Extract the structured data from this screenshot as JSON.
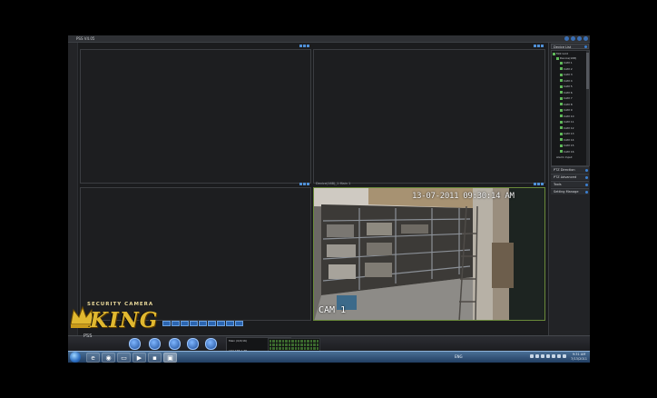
{
  "window": {
    "title": "PSS  V4.05"
  },
  "panes": [
    {
      "title": ""
    },
    {
      "title": ""
    },
    {
      "title": ""
    },
    {
      "title": "Device(168)_1 Main 1",
      "timestamp": "13-07-2011 09:30:14 AM",
      "channel": "CAM 1"
    }
  ],
  "right_panel": {
    "device_list_label": "Device List",
    "tree_root": "Mot Grid",
    "tree_device": "Device(168)",
    "cameras": [
      "CAM 1",
      "CAM 2",
      "CAM 3",
      "CAM 4",
      "CAM 5",
      "CAM 6",
      "CAM 7",
      "CAM 8",
      "CAM 9",
      "CAM 10",
      "CAM 11",
      "CAM 12",
      "CAM 13",
      "CAM 14",
      "CAM 15",
      "CAM 16"
    ],
    "tree_tail": "Alarm Input",
    "menu": [
      "PTZ Direction",
      "PTZ Advanced",
      "Tools",
      "Setting Manage"
    ]
  },
  "toolbar": {
    "tools": [
      "Task",
      "Alarm",
      "Playback",
      "E-map",
      "Config"
    ],
    "status_line1": "Main (0/0/16)",
    "status_line2": "192.168.1.38"
  },
  "logo": {
    "tagline": "SECURITY CAMERA",
    "brand": "KING",
    "product": "PSS"
  },
  "taskbar": {
    "lang": "ENG",
    "time": "9:31 AM",
    "date": "7/13/2011"
  },
  "colors": {
    "accent": "#3b7fd0",
    "logo_gold": "#e0b830"
  }
}
